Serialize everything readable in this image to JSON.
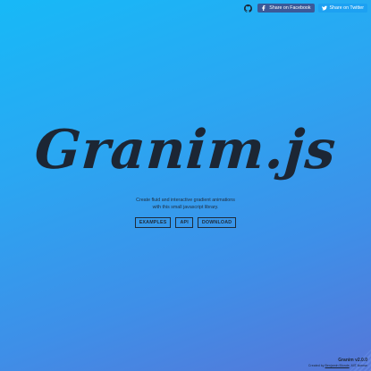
{
  "header": {
    "github_icon": "github-icon",
    "facebook": {
      "icon": "facebook-icon",
      "label": "Share on Facebook"
    },
    "twitter": {
      "icon": "twitter-icon",
      "label": "Share on Twitter"
    }
  },
  "hero": {
    "title": "Granim.js",
    "tagline_line1": "Create fluid and interactive gradient animations",
    "tagline_line2": "with this small javascript library.",
    "buttons": [
      "EXAMPLES",
      "API",
      "DOWNLOAD"
    ]
  },
  "footer": {
    "version": "Granim v2.0.0",
    "credits_prefix": "Created by",
    "author": "Benjamin Blonde",
    "credits_suffix": ", MIT license"
  },
  "colors": {
    "gradient_start": "#17b9f7",
    "gradient_end": "#5677d8",
    "facebook": "#3b5998",
    "twitter": "#1da1f2",
    "text": "#1c2634"
  }
}
